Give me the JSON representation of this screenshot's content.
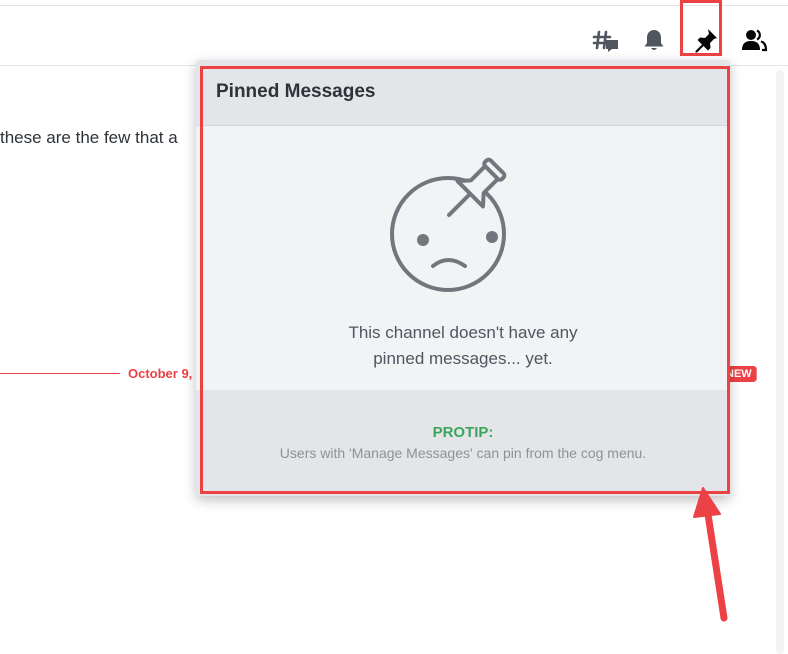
{
  "header": {
    "icons": [
      "threads-icon",
      "bell-icon",
      "pin-icon",
      "members-icon"
    ]
  },
  "chat": {
    "message_fragment": "these are the few that a",
    "date_divider_label": "October 9,",
    "new_badge": "NEW"
  },
  "popout": {
    "title": "Pinned Messages",
    "empty_line1": "This channel doesn't have any",
    "empty_line2": "pinned messages... yet.",
    "protip_title": "PROTIP:",
    "protip_text": "Users with 'Manage Messages' can pin from the cog menu."
  },
  "colors": {
    "accent_red": "#ed4245",
    "protip_green": "#3ba55d",
    "popout_bg": "#f2f3f5",
    "header_bg": "#e3e5e8"
  }
}
